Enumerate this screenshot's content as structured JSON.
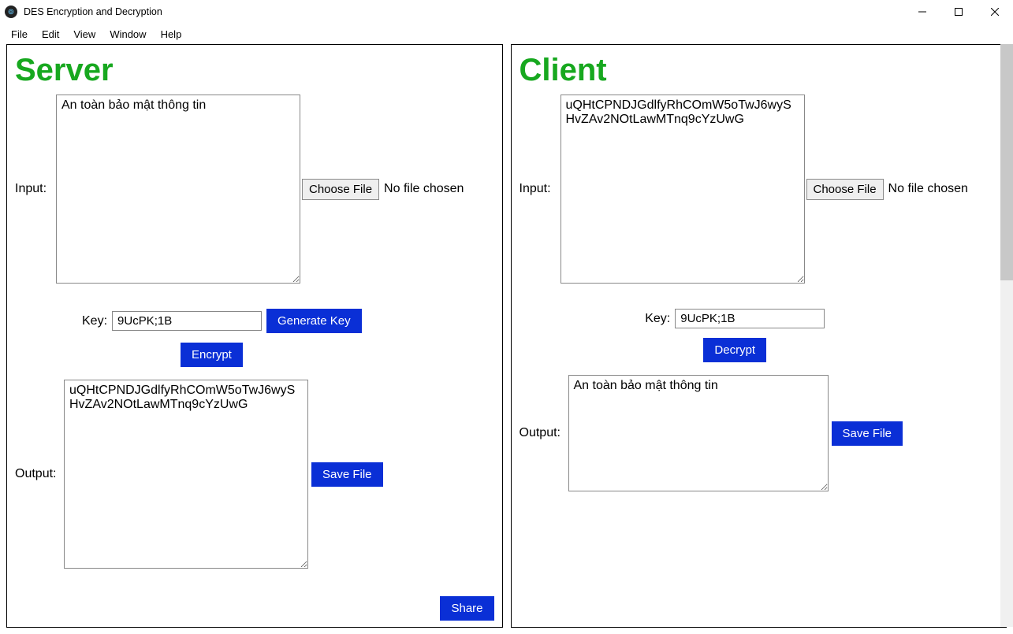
{
  "window": {
    "title": "DES Encryption and Decryption"
  },
  "menu": {
    "file": "File",
    "edit": "Edit",
    "view": "View",
    "window": "Window",
    "help": "Help"
  },
  "labels": {
    "input": "Input:",
    "output": "Output:",
    "key": "Key:",
    "choose_file": "Choose File",
    "no_file": "No file chosen",
    "generate_key": "Generate Key",
    "encrypt": "Encrypt",
    "decrypt": "Decrypt",
    "save_file": "Save File",
    "share": "Share"
  },
  "server": {
    "title": "Server",
    "input_value": "An toàn bảo mật thông tin",
    "key_value": "9UcPK;1B",
    "output_value": "uQHtCPNDJGdlfyRhCOmW5oTwJ6wySHvZAv2NOtLawMTnq9cYzUwG"
  },
  "client": {
    "title": "Client",
    "input_value": "uQHtCPNDJGdlfyRhCOmW5oTwJ6wySHvZAv2NOtLawMTnq9cYzUwG",
    "key_value": "9UcPK;1B",
    "output_value": "An toàn bảo mật thông tin"
  }
}
